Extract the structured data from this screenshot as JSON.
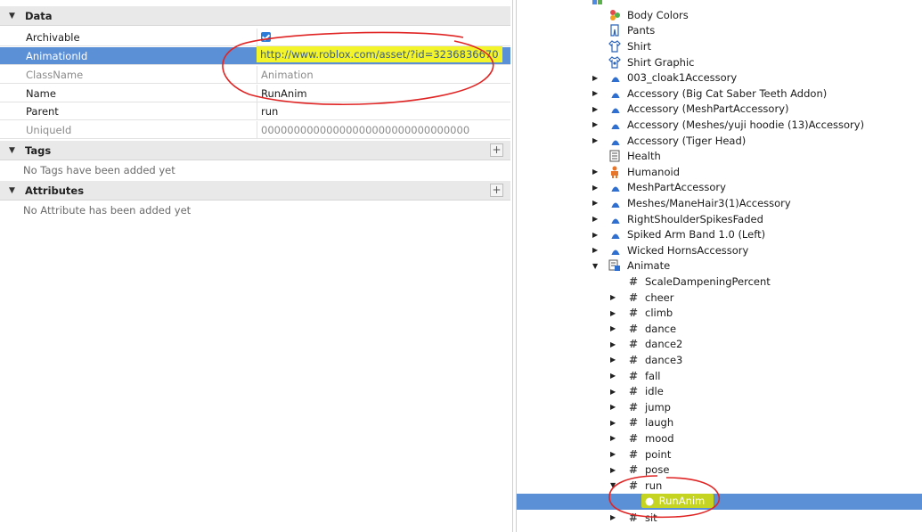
{
  "properties": {
    "data_section": {
      "title": "Data"
    },
    "rows": [
      {
        "name": "Archivable",
        "value": ""
      },
      {
        "name": "AnimationId",
        "value": "http://www.roblox.com/asset/?id=3236836670"
      },
      {
        "name": "ClassName",
        "value": "Animation"
      },
      {
        "name": "Name",
        "value": "RunAnim"
      },
      {
        "name": "Parent",
        "value": "run"
      },
      {
        "name": "UniqueId",
        "value": "00000000000000000000000000000000"
      }
    ],
    "tags_section": {
      "title": "Tags",
      "empty": "No Tags have been added yet"
    },
    "attributes_section": {
      "title": "Attributes",
      "empty": "No Attribute has been added yet"
    }
  },
  "explorer": {
    "items": [
      {
        "label": "Body Colors"
      },
      {
        "label": "Pants"
      },
      {
        "label": "Shirt"
      },
      {
        "label": "Shirt Graphic"
      },
      {
        "label": "003_cloak1Accessory"
      },
      {
        "label": "Accessory (Big Cat Saber Teeth Addon)"
      },
      {
        "label": "Accessory (MeshPartAccessory)"
      },
      {
        "label": "Accessory (Meshes/yuji hoodie (13)Accessory)"
      },
      {
        "label": "Accessory (Tiger Head)"
      },
      {
        "label": "Health"
      },
      {
        "label": "Humanoid"
      },
      {
        "label": "MeshPartAccessory"
      },
      {
        "label": "Meshes/ManeHair3(1)Accessory"
      },
      {
        "label": "RightShoulderSpikesFaded"
      },
      {
        "label": "Spiked Arm Band 1.0 (Left)"
      },
      {
        "label": "Wicked HornsAccessory"
      },
      {
        "label": "Animate"
      },
      {
        "label": "ScaleDampeningPercent"
      },
      {
        "label": "cheer"
      },
      {
        "label": "climb"
      },
      {
        "label": "dance"
      },
      {
        "label": "dance2"
      },
      {
        "label": "dance3"
      },
      {
        "label": "fall"
      },
      {
        "label": "idle"
      },
      {
        "label": "jump"
      },
      {
        "label": "laugh"
      },
      {
        "label": "mood"
      },
      {
        "label": "point"
      },
      {
        "label": "pose"
      },
      {
        "label": "run"
      },
      {
        "label": "RunAnim"
      },
      {
        "label": "sit"
      }
    ]
  },
  "colors": {
    "selection": "#5b8fd6",
    "highlight": "#f3f52a",
    "annotation": "#e02424"
  }
}
